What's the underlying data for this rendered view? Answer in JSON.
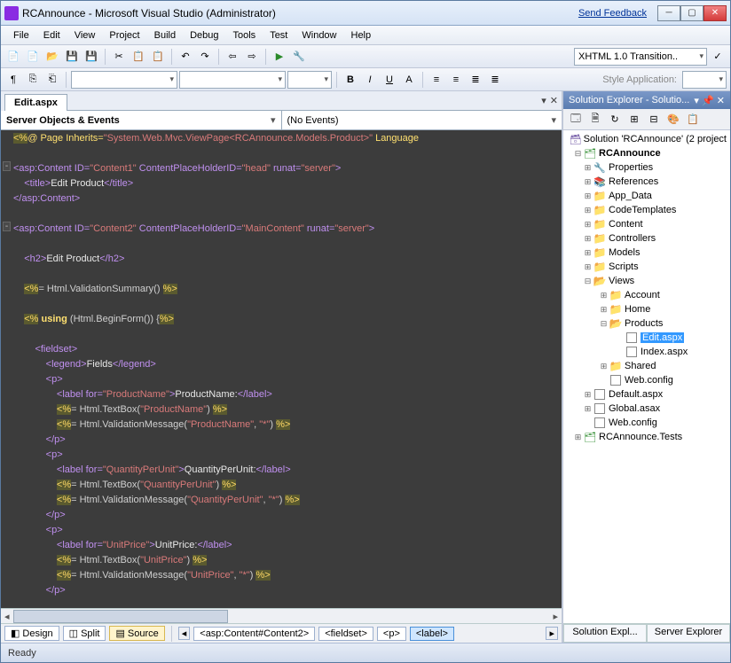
{
  "title": "RCAnnounce - Microsoft Visual Studio (Administrator)",
  "feedback": "Send Feedback",
  "menu": [
    "File",
    "Edit",
    "View",
    "Project",
    "Build",
    "Debug",
    "Tools",
    "Test",
    "Window",
    "Help"
  ],
  "toolbar2": {
    "doctype": "XHTML 1.0 Transition..",
    "styleapp": "Style Application:"
  },
  "tab": "Edit.aspx",
  "dropdowns": {
    "left": "Server Objects & Events",
    "right": "(No Events)"
  },
  "code": {
    "l1a": "<%",
    "l1b": "@ Page Inherits=",
    "l1c": "\"System.Web.Mvc.ViewPage<RCAnnounce.Models.Product>\"",
    "l1d": " Language",
    "l2a": "<asp:Content ID=",
    "l2b": "\"Content1\"",
    "l2c": " ContentPlaceHolderID=",
    "l2d": "\"head\"",
    "l2e": " runat=",
    "l2f": "\"server\"",
    "l2g": ">",
    "l3a": "    <title>",
    "l3b": "Edit Product",
    "l3c": "</title>",
    "l4": "</asp:Content>",
    "l5a": "<asp:Content ID=",
    "l5b": "\"Content2\"",
    "l5c": " ContentPlaceHolderID=",
    "l5d": "\"MainContent\"",
    "l5e": " runat=",
    "l5f": "\"server\"",
    "l5g": ">",
    "l6a": "    <h2>",
    "l6b": "Edit Product",
    "l6c": "</h2>",
    "l7a": "    ",
    "l7b": "<%",
    "l7c": "= Html.ValidationSummary() ",
    "l7d": "%>",
    "l8a": "    ",
    "l8b": "<%",
    "l8c": " ",
    "l8d": "using",
    "l8e": " (Html.BeginForm()) {",
    "l8f": "%>",
    "l9": "        <fieldset>",
    "l10a": "            <legend>",
    "l10b": "Fields",
    "l10c": "</legend>",
    "l11": "            <p>",
    "l12a": "                <label for=",
    "l12b": "\"ProductName\"",
    "l12c": ">",
    "l12d": "ProductName:",
    "l12e": "</label>",
    "l13a": "                ",
    "l13b": "<%",
    "l13c": "= Html.TextBox(",
    "l13d": "\"ProductName\"",
    "l13e": ") ",
    "l13f": "%>",
    "l14a": "                ",
    "l14b": "<%",
    "l14c": "= Html.ValidationMessage(",
    "l14d": "\"ProductName\"",
    "l14e": ", ",
    "l14f": "\"*\"",
    "l14g": ") ",
    "l14h": "%>",
    "l15": "            </p>",
    "l16": "            <p>",
    "l17a": "                <label for=",
    "l17b": "\"QuantityPerUnit\"",
    "l17c": ">",
    "l17d": "QuantityPerUnit:",
    "l17e": "</label>",
    "l18a": "                ",
    "l18b": "<%",
    "l18c": "= Html.TextBox(",
    "l18d": "\"QuantityPerUnit\"",
    "l18e": ") ",
    "l18f": "%>",
    "l19a": "                ",
    "l19b": "<%",
    "l19c": "= Html.ValidationMessage(",
    "l19d": "\"QuantityPerUnit\"",
    "l19e": ", ",
    "l19f": "\"*\"",
    "l19g": ") ",
    "l19h": "%>",
    "l20": "            </p>",
    "l21": "            <p>",
    "l22a": "                <label for=",
    "l22b": "\"UnitPrice\"",
    "l22c": ">",
    "l22d": "UnitPrice:",
    "l22e": "</label>",
    "l23a": "                ",
    "l23b": "<%",
    "l23c": "= Html.TextBox(",
    "l23d": "\"UnitPrice\"",
    "l23e": ") ",
    "l23f": "%>",
    "l24a": "                ",
    "l24b": "<%",
    "l24c": "= Html.ValidationMessage(",
    "l24d": "\"UnitPrice\"",
    "l24e": ", ",
    "l24f": "\"*\"",
    "l24g": ") ",
    "l24h": "%>",
    "l25": "            </p>"
  },
  "viewbar": {
    "design": "Design",
    "split": "Split",
    "source": "Source"
  },
  "crumbs": [
    "<asp:Content#Content2>",
    "<fieldset>",
    "<p>",
    "<label>"
  ],
  "solution": {
    "title": "Solution Explorer - Solutio...",
    "root": "Solution 'RCAnnounce' (2 project",
    "proj": "RCAnnounce",
    "nodes": [
      "Properties",
      "References",
      "App_Data",
      "CodeTemplates",
      "Content",
      "Controllers",
      "Models",
      "Scripts",
      "Views"
    ],
    "views": [
      "Account",
      "Home",
      "Products"
    ],
    "products": [
      "Edit.aspx",
      "Index.aspx"
    ],
    "shared": "Shared",
    "webconfig": "Web.config",
    "rootfiles": [
      "Default.aspx",
      "Global.asax",
      "Web.config"
    ],
    "tests": "RCAnnounce.Tests"
  },
  "sidetabs": [
    "Solution Expl...",
    "Server Explorer"
  ],
  "status": "Ready"
}
